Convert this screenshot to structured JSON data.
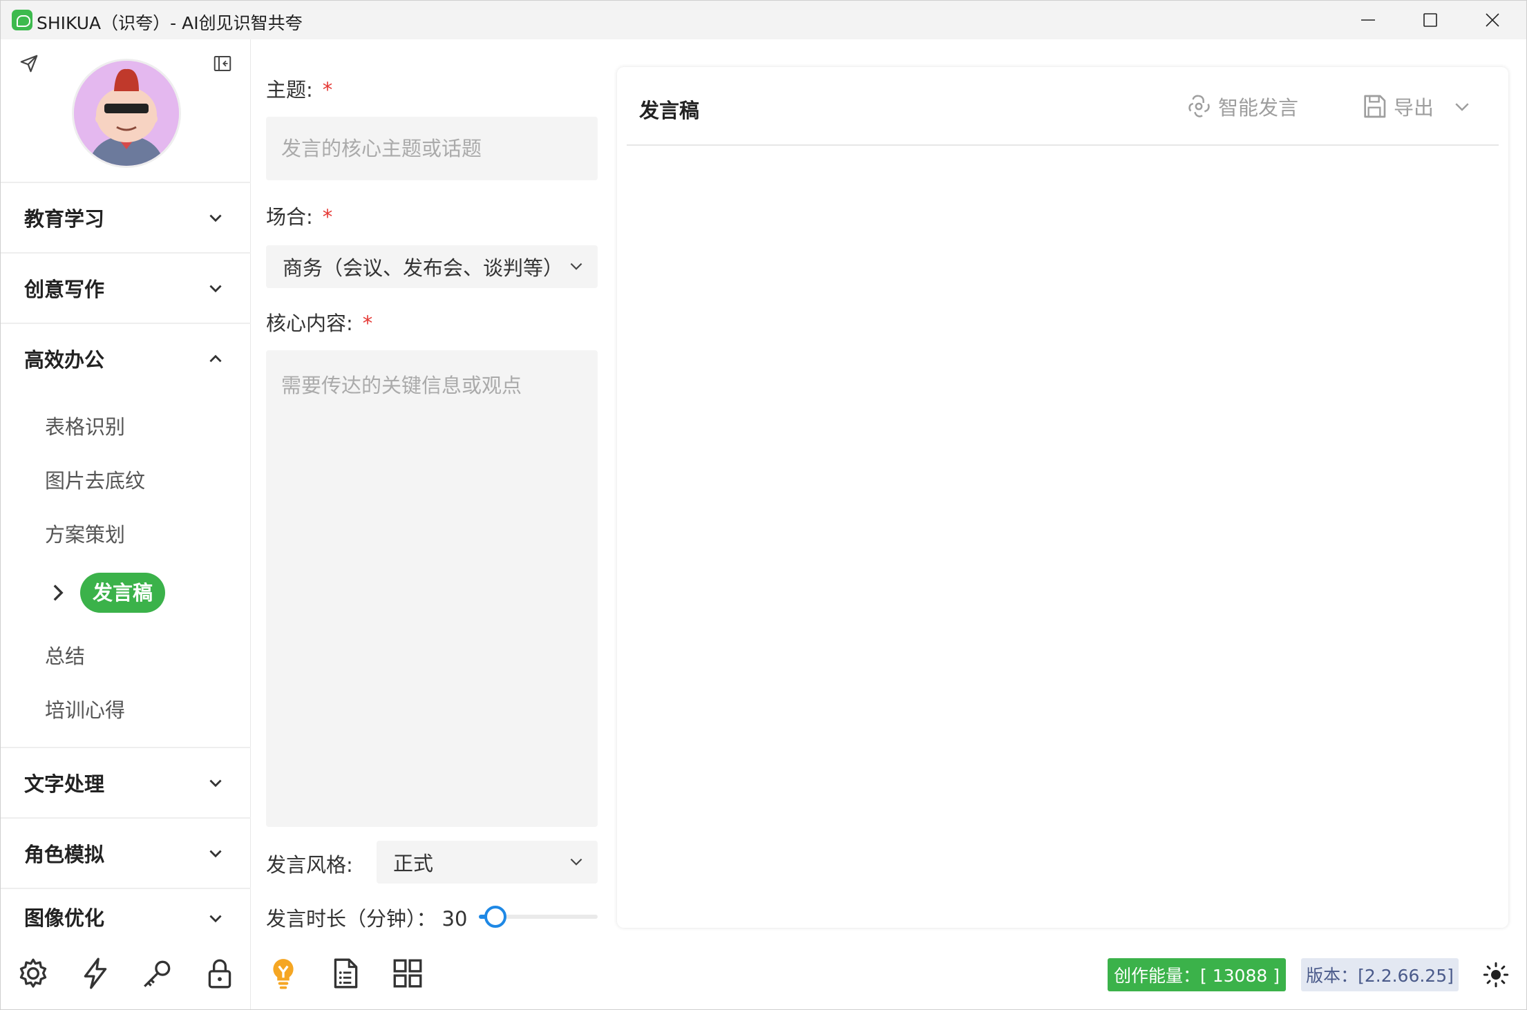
{
  "window": {
    "title": "SHIKUA（识夸）- AI创见识智共夸"
  },
  "sidebar": {
    "groups": [
      {
        "label": "教育学习",
        "expanded": false
      },
      {
        "label": "创意写作",
        "expanded": false
      },
      {
        "label": "高效办公",
        "expanded": true,
        "items": [
          "表格识别",
          "图片去底纹",
          "方案策划",
          "发言稿",
          "总结",
          "培训心得"
        ],
        "active_item": "发言稿"
      },
      {
        "label": "文字处理",
        "expanded": false
      },
      {
        "label": "角色模拟",
        "expanded": false
      },
      {
        "label": "图像优化",
        "expanded": false
      }
    ],
    "bottom_icons": [
      "gear-icon",
      "lightning-icon",
      "key-icon",
      "lock-icon"
    ]
  },
  "form": {
    "topic": {
      "label": "主题:",
      "required_mark": "*",
      "placeholder": "发言的核心主题或话题"
    },
    "occasion": {
      "label": "场合:",
      "required_mark": "*",
      "value": "商务（会议、发布会、谈判等）"
    },
    "core": {
      "label": "核心内容:",
      "required_mark": "*",
      "placeholder": "需要传达的关键信息或观点"
    },
    "style": {
      "label": "发言风格:",
      "value": "正式"
    },
    "duration": {
      "label": "发言时长（分钟）：",
      "value": "30",
      "level": 0.06
    },
    "tools": [
      "lightbulb-icon",
      "document-icon",
      "grid-icon"
    ]
  },
  "output": {
    "title": "发言稿",
    "smart_button": "智能发言",
    "export_button": "导出"
  },
  "footer": {
    "energy": "创作能量：[ 13088 ]",
    "version": "版本：[2.2.66.25]"
  },
  "colors": {
    "accent": "#3bb24a",
    "slider": "#1e88e5",
    "required": "#e53935"
  }
}
